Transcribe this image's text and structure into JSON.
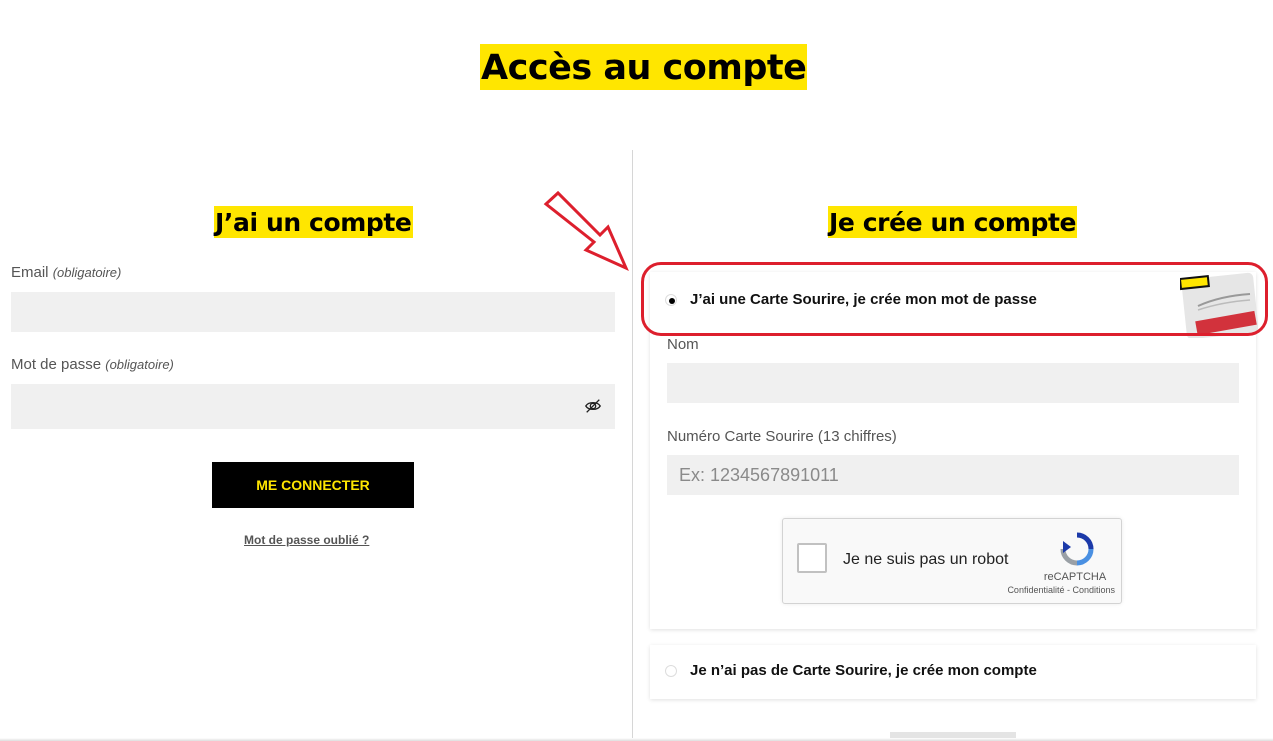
{
  "page": {
    "title": "Accès au compte"
  },
  "login": {
    "title": "J’ai un compte",
    "email_label": "Email",
    "email_required": "(obligatoire)",
    "email_value": "",
    "password_label": "Mot de passe",
    "password_required": "(obligatoire)",
    "password_value": "",
    "button_label": "ME CONNECTER",
    "forgot_link": "Mot de passe oublié ?"
  },
  "signup": {
    "title": "Je crée un compte",
    "option_card": {
      "label": "J’ai une Carte Sourire, je crée mon mot de passe",
      "selected": true
    },
    "nom_label": "Nom",
    "nom_value": "",
    "card_number_label": "Numéro Carte Sourire (13 chiffres)",
    "card_number_placeholder": "Ex: 1234567891011",
    "recaptcha": {
      "label": "Je ne suis pas un robot",
      "brand": "reCAPTCHA",
      "links": "Confidentialité - Conditions"
    },
    "option_no_card": {
      "label": "Je n’ai pas de Carte Sourire, je crée mon compte",
      "selected": false
    }
  },
  "colors": {
    "accent_yellow": "#ffe600",
    "annotation_red": "#dd1f2d",
    "button_black": "#000000",
    "field_gray": "#f0f0f0"
  }
}
